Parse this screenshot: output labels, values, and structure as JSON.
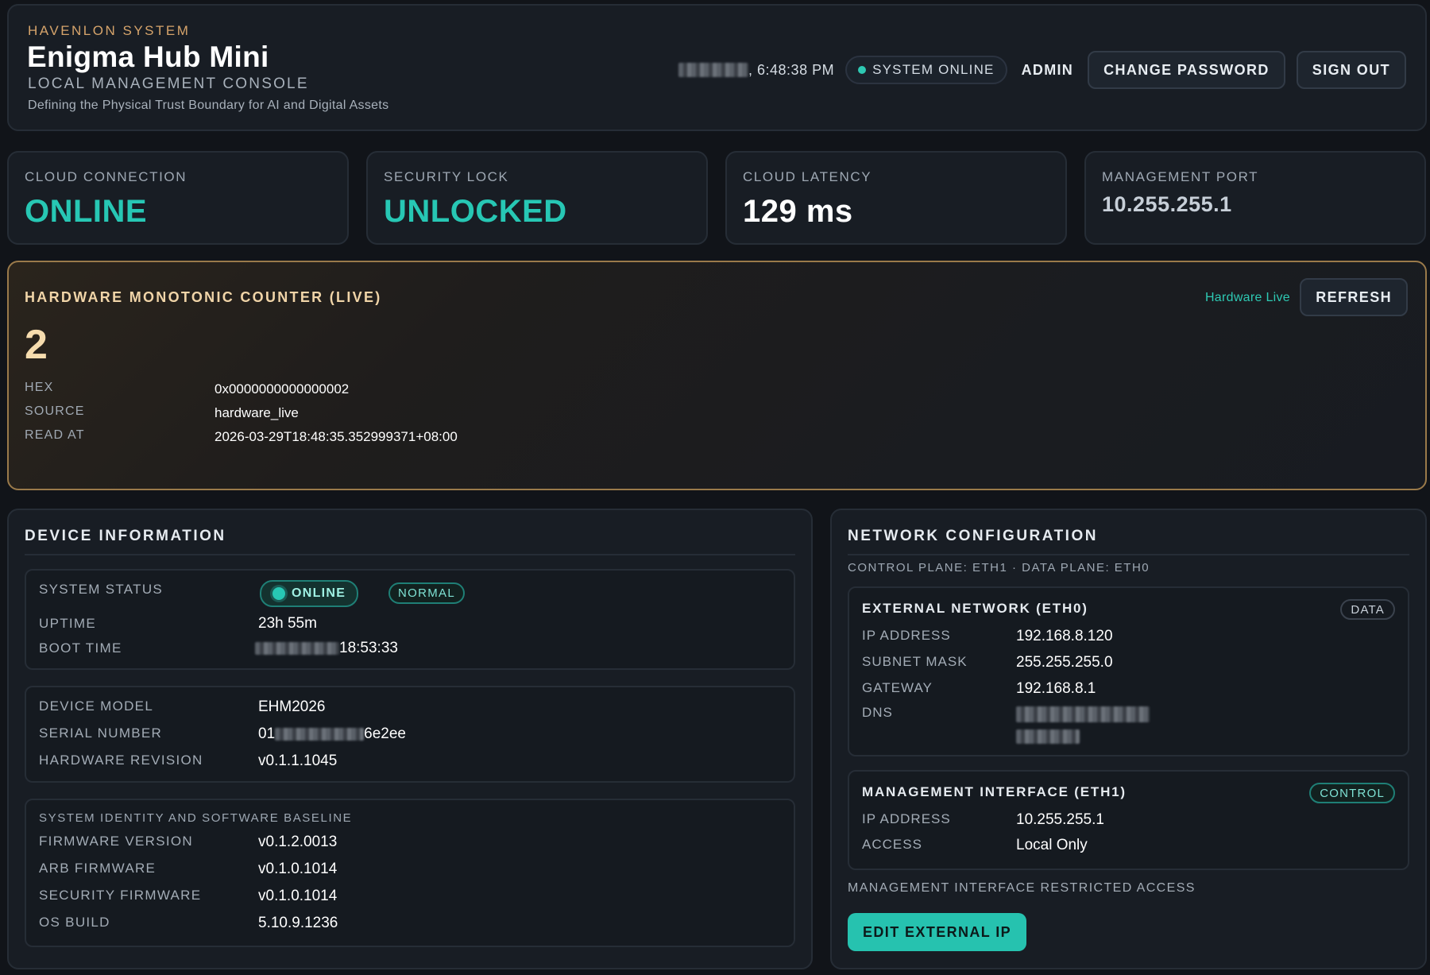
{
  "header": {
    "kicker": "HAVENLON SYSTEM",
    "title": "Enigma Hub Mini",
    "subtitle": "LOCAL MANAGEMENT CONSOLE",
    "tagline": "Defining the Physical Trust Boundary for AI and Digital Assets",
    "clock_time": ", 6:48:38 PM",
    "status": "SYSTEM ONLINE",
    "user": "ADMIN",
    "change_password": "CHANGE PASSWORD",
    "sign_out": "SIGN OUT"
  },
  "stats": [
    {
      "label": "CLOUD CONNECTION",
      "value": "ONLINE"
    },
    {
      "label": "SECURITY LOCK",
      "value": "UNLOCKED"
    },
    {
      "label": "CLOUD LATENCY",
      "value": "129 ms"
    },
    {
      "label": "MANAGEMENT PORT",
      "value": "10.255.255.1"
    }
  ],
  "counter": {
    "title": "HARDWARE MONOTONIC COUNTER (LIVE)",
    "live_label": "Hardware Live",
    "refresh": "REFRESH",
    "value": "2",
    "rows": [
      {
        "label": "HEX",
        "value": "0x0000000000000002"
      },
      {
        "label": "SOURCE",
        "value": "hardware_live"
      },
      {
        "label": "READ AT",
        "value": "2026-03-29T18:48:35.352999371+08:00"
      }
    ]
  },
  "device": {
    "title": "DEVICE INFORMATION",
    "status": {
      "system_status_label": "SYSTEM STATUS",
      "online_badge": "ONLINE",
      "normal_badge": "NORMAL",
      "uptime_label": "UPTIME",
      "uptime_value": "23h 55m",
      "boot_time_label": "BOOT TIME",
      "boot_time_value": "18:53:33"
    },
    "hardware": {
      "model_label": "DEVICE MODEL",
      "model_value": "EHM2026",
      "serial_label": "SERIAL NUMBER",
      "serial_prefix": "01",
      "serial_suffix": "6e2ee",
      "revision_label": "HARDWARE REVISION",
      "revision_value": "v0.1.1.1045"
    },
    "software": {
      "caption": "SYSTEM IDENTITY AND SOFTWARE BASELINE",
      "rows": [
        {
          "label": "FIRMWARE VERSION",
          "value": "v0.1.2.0013"
        },
        {
          "label": "ARB FIRMWARE",
          "value": "v0.1.0.1014"
        },
        {
          "label": "SECURITY FIRMWARE",
          "value": "v0.1.0.1014"
        },
        {
          "label": "OS BUILD",
          "value": "5.10.9.1236"
        }
      ]
    }
  },
  "network": {
    "title": "NETWORK CONFIGURATION",
    "caption": "CONTROL PLANE: ETH1 · DATA PLANE: ETH0",
    "external": {
      "title": "EXTERNAL NETWORK (ETH0)",
      "tag": "DATA",
      "ip_label": "IP ADDRESS",
      "ip_value": "192.168.8.120",
      "mask_label": "SUBNET MASK",
      "mask_value": "255.255.255.0",
      "gateway_label": "GATEWAY",
      "gateway_value": "192.168.8.1",
      "dns_label": "DNS"
    },
    "management": {
      "title": "MANAGEMENT INTERFACE (ETH1)",
      "tag": "CONTROL",
      "ip_label": "IP ADDRESS",
      "ip_value": "10.255.255.1",
      "access_label": "ACCESS",
      "access_value": "Local Only"
    },
    "restricted": "MANAGEMENT INTERFACE RESTRICTED ACCESS",
    "edit_button": "EDIT EXTERNAL IP"
  }
}
